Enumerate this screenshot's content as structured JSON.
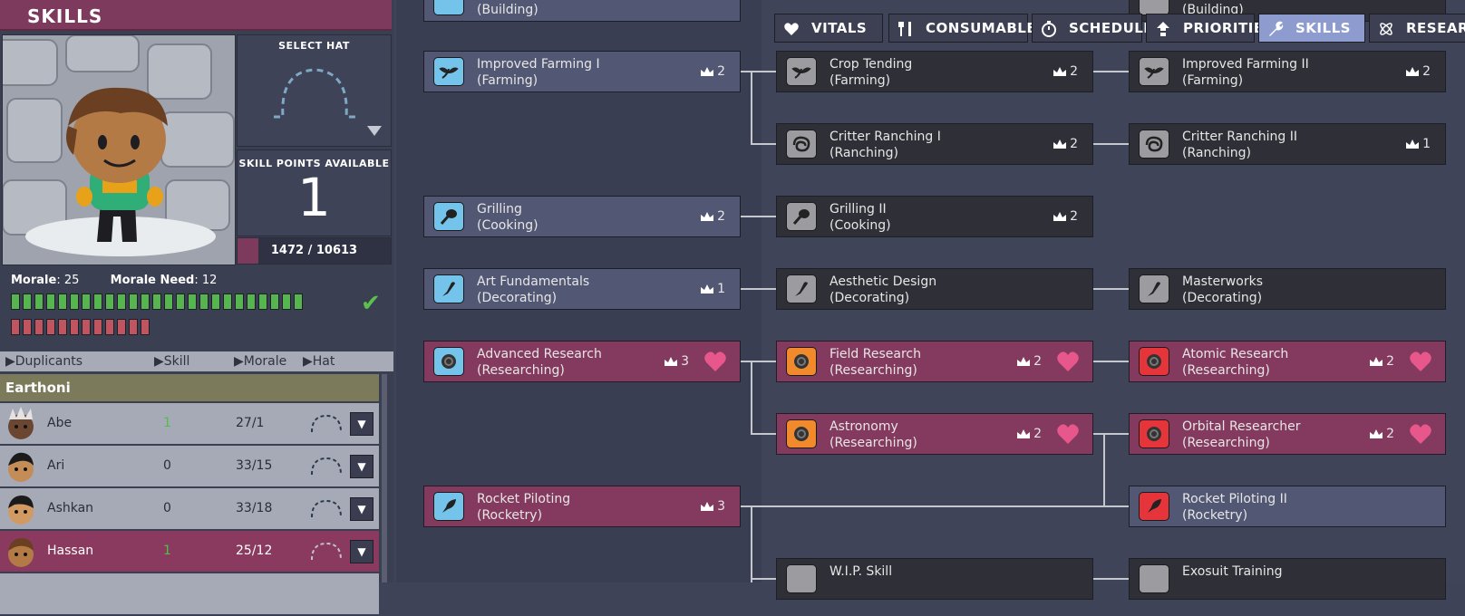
{
  "panel": {
    "title": "SKILLS"
  },
  "hat_box": {
    "label": "SELECT HAT"
  },
  "skill_points": {
    "label": "SKILL POINTS AVAILABLE",
    "value": "1",
    "xp_text": "1472 / 10613",
    "xp_fraction": 0.139
  },
  "morale": {
    "morale_label": "Morale",
    "morale_value": ": 25",
    "need_label": "Morale Need",
    "need_value": ": 12",
    "green_pips": 25,
    "red_pips": 12
  },
  "list_header": {
    "duplicants": "Duplicants",
    "skill_points": "Skill Points",
    "morale": "Morale",
    "hat": "Hat"
  },
  "group": {
    "name": "Earthoni"
  },
  "duplicants": [
    {
      "name": "Abe",
      "points": "1",
      "morale": "27/1"
    },
    {
      "name": "Ari",
      "points": "0",
      "morale": "33/15"
    },
    {
      "name": "Ashkan",
      "points": "0",
      "morale": "33/18"
    },
    {
      "name": "Hassan",
      "points": "1",
      "morale": "25/12"
    }
  ],
  "tabs": [
    {
      "label": "VITALS",
      "icon": "heart-icon"
    },
    {
      "label": "CONSUMABLES",
      "icon": "cutlery-icon"
    },
    {
      "label": "SCHEDULE",
      "icon": "stopwatch-icon"
    },
    {
      "label": "PRIORITIES",
      "icon": "priority-icon"
    },
    {
      "label": "SKILLS",
      "icon": "wrench-icon"
    },
    {
      "label": "RESEARC",
      "icon": "atom-icon"
    }
  ],
  "skills": {
    "building_top_1": {
      "line2": "(Building)"
    },
    "building_top_2": {
      "line2": "(Building)"
    },
    "improved_farming_1": {
      "line1": "Improved Farming I",
      "line2": "(Farming)",
      "count": "2"
    },
    "crop_tending": {
      "line1": "Crop Tending",
      "line2": "(Farming)",
      "count": "2"
    },
    "improved_farming_2": {
      "line1": "Improved Farming II",
      "line2": "(Farming)",
      "count": "2"
    },
    "critter_ranching_1": {
      "line1": "Critter Ranching I",
      "line2": "(Ranching)",
      "count": "2"
    },
    "critter_ranching_2": {
      "line1": "Critter Ranching II",
      "line2": "(Ranching)",
      "count": "1"
    },
    "grilling": {
      "line1": "Grilling",
      "line2": "(Cooking)",
      "count": "2"
    },
    "grilling_2": {
      "line1": "Grilling II",
      "line2": "(Cooking)",
      "count": "2"
    },
    "art_fundamentals": {
      "line1": "Art Fundamentals",
      "line2": "(Decorating)",
      "count": "1"
    },
    "aesthetic_design": {
      "line1": "Aesthetic Design",
      "line2": "(Decorating)"
    },
    "masterworks": {
      "line1": "Masterworks",
      "line2": "(Decorating)"
    },
    "advanced_research": {
      "line1": "Advanced Research",
      "line2": "(Researching)",
      "count": "3"
    },
    "field_research": {
      "line1": "Field Research",
      "line2": "(Researching)",
      "count": "2"
    },
    "atomic_research": {
      "line1": "Atomic Research",
      "line2": "(Researching)",
      "count": "2"
    },
    "astronomy": {
      "line1": "Astronomy",
      "line2": "(Researching)",
      "count": "2"
    },
    "orbital_researcher": {
      "line1": "Orbital Researcher",
      "line2": "(Researching)",
      "count": "2"
    },
    "rocket_piloting": {
      "line1": "Rocket Piloting",
      "line2": "(Rocketry)",
      "count": "3"
    },
    "rocket_piloting_2": {
      "line1": "Rocket Piloting II",
      "line2": "(Rocketry)"
    },
    "wip_skill": {
      "line1": "W.I.P. Skill"
    },
    "exosuit_training": {
      "line1": "Exosuit Training"
    }
  },
  "colors": {
    "learned": "#525874",
    "locked": "#2f3037",
    "interest": "#843a5e",
    "accent": "#7d3a5c"
  }
}
